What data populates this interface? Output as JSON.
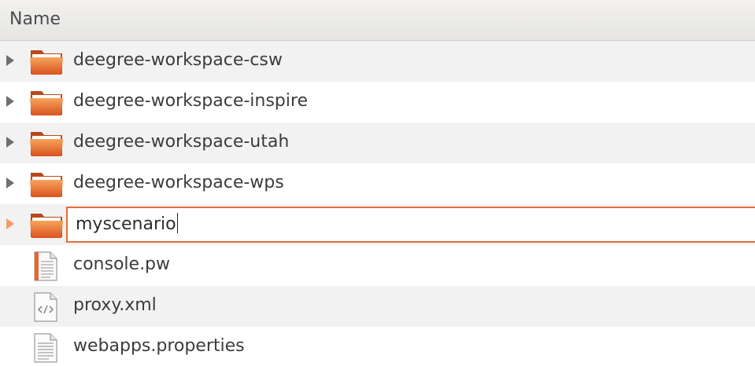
{
  "header": {
    "name_column": "Name"
  },
  "folders": [
    {
      "name": "deegree-workspace-csw"
    },
    {
      "name": "deegree-workspace-inspire"
    },
    {
      "name": "deegree-workspace-utah"
    },
    {
      "name": "deegree-workspace-wps"
    }
  ],
  "rename": {
    "value": "myscenario"
  },
  "files": [
    {
      "name": "console.pw",
      "icon": "text-file-icon"
    },
    {
      "name": "proxy.xml",
      "icon": "xml-file-icon"
    },
    {
      "name": "webapps.properties",
      "icon": "text-file-icon"
    }
  ],
  "colors": {
    "accent": "#e46c3a",
    "folder_orange": "#e8662a",
    "alt_row": "#f2f2f2"
  }
}
